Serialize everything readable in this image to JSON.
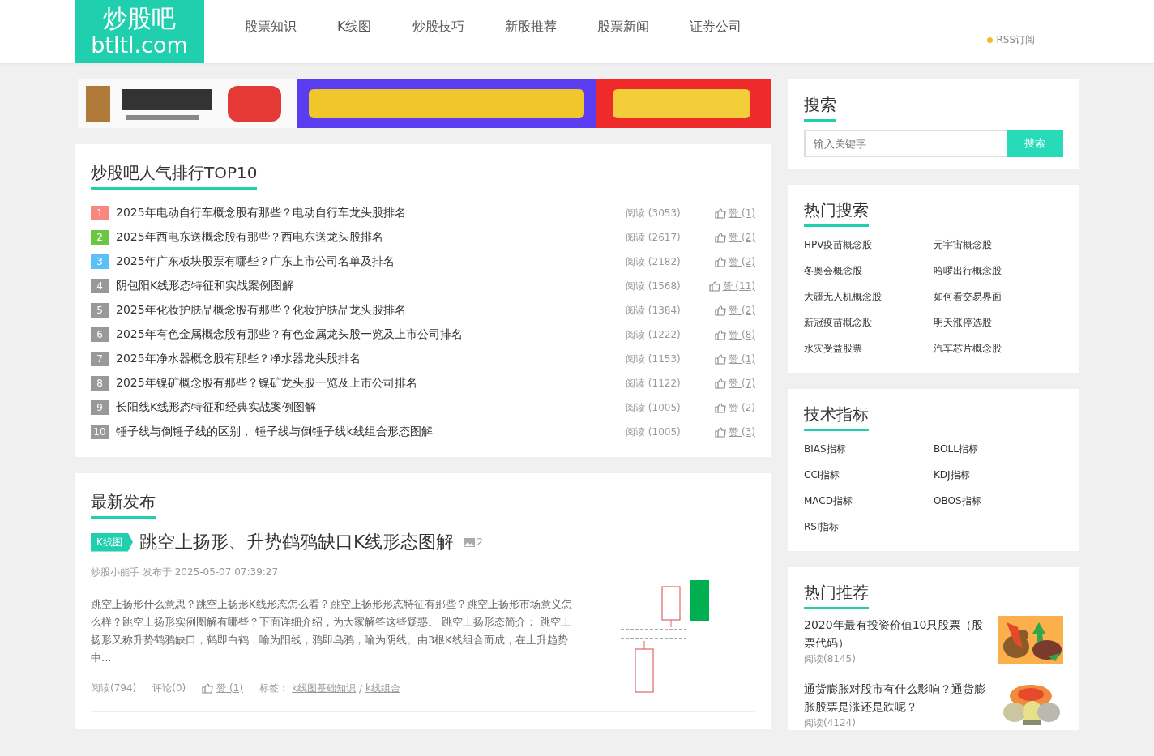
{
  "header": {
    "logo_title": "炒股吧",
    "logo_domain": "btltl.com",
    "nav": [
      {
        "label": "股票知识"
      },
      {
        "label": "K线图"
      },
      {
        "label": "炒股技巧"
      },
      {
        "label": "新股推荐"
      },
      {
        "label": "股票新闻"
      },
      {
        "label": "证券公司"
      }
    ],
    "rss": "RSS订阅"
  },
  "ranking": {
    "title": "炒股吧人气排行TOP10",
    "items": [
      {
        "rank": "1",
        "color": "#f8877f",
        "title": "2025年电动自行车概念股有那些？电动自行车龙头股排名",
        "reads": "阅读 (3053)",
        "likes": "赞 (1)"
      },
      {
        "rank": "2",
        "color": "#6cc644",
        "title": "2025年西电东送概念股有那些？西电东送龙头股排名",
        "reads": "阅读 (2617)",
        "likes": "赞 (2)"
      },
      {
        "rank": "3",
        "color": "#5bc0f8",
        "title": "2025年广东板块股票有哪些？广东上市公司名单及排名",
        "reads": "阅读 (2182)",
        "likes": "赞 (2)"
      },
      {
        "rank": "4",
        "color": "#999999",
        "title": "阴包阳K线形态特征和实战案例图解",
        "reads": "阅读 (1568)",
        "likes": "赞 (11)"
      },
      {
        "rank": "5",
        "color": "#999999",
        "title": "2025年化妆护肤品概念股有那些？化妆护肤品龙头股排名",
        "reads": "阅读 (1384)",
        "likes": "赞 (2)"
      },
      {
        "rank": "6",
        "color": "#999999",
        "title": "2025年有色金属概念股有那些？有色金属龙头股一览及上市公司排名",
        "reads": "阅读 (1222)",
        "likes": "赞 (8)"
      },
      {
        "rank": "7",
        "color": "#999999",
        "title": "2025年净水器概念股有那些？净水器龙头股排名",
        "reads": "阅读 (1153)",
        "likes": "赞 (1)"
      },
      {
        "rank": "8",
        "color": "#999999",
        "title": "2025年镍矿概念股有那些？镍矿龙头股一览及上市公司排名",
        "reads": "阅读 (1122)",
        "likes": "赞 (7)"
      },
      {
        "rank": "9",
        "color": "#999999",
        "title": "长阳线K线形态特征和经典实战案例图解",
        "reads": "阅读 (1005)",
        "likes": "赞 (2)"
      },
      {
        "rank": "10",
        "color": "#999999",
        "title": "锤子线与倒锤子线的区别， 锤子线与倒锤子线k线组合形态图解",
        "reads": "阅读 (1005)",
        "likes": "赞 (3)"
      }
    ]
  },
  "latest": {
    "title": "最新发布",
    "articles": [
      {
        "tag": "K线图",
        "title": "跳空上扬形、升势鹤鸦缺口K线形态图解",
        "image_count": "2",
        "meta": "炒股小能手 发布于 2025-05-07 07:39:27",
        "summary": "跳空上扬形什么意思？跳空上扬形K线形态怎么看？跳空上扬形形态特征有那些？跳空上扬形市场意义怎么样？跳空上扬形实例图解有哪些？下面详细介绍，为大家解答这些疑惑。 跳空上扬形态简介： 跳空上扬形又称升势鹤鸦缺口，鹤即白鹤，喻为阳线，鸦即乌鸦，喻为阴线。由3根K线组合而成，在上升趋势中...",
        "reads": "阅读(794)",
        "comments": "评论(0)",
        "likes": "赞 (1)",
        "tags_label": "标签：",
        "tags": [
          "k线图基础知识",
          "k线组合"
        ],
        "tag_separator": "/"
      }
    ]
  },
  "sidebar": {
    "search": {
      "title": "搜索",
      "placeholder": "输入关键字",
      "button": "搜索"
    },
    "hot_search": {
      "title": "热门搜索",
      "links": [
        "HPV疫苗概念股",
        "元宇宙概念股",
        "冬奥会概念股",
        "哈啰出行概念股",
        "大疆无人机概念股",
        "如何看交易界面",
        "新冠疫苗概念股",
        "明天涨停选股",
        "水灾受益股票",
        "汽车芯片概念股"
      ]
    },
    "indicators": {
      "title": "技术指标",
      "links": [
        "BIAS指标",
        "BOLL指标",
        "CCI指标",
        "KDJ指标",
        "MACD指标",
        "OBOS指标",
        "RSI指标"
      ]
    },
    "recommend": {
      "title": "热门推荐",
      "items": [
        {
          "title": "2020年最有投资价值10只股票（股票代码）",
          "reads": "阅读(8145)",
          "kind": "picture"
        },
        {
          "title": "通货膨胀对股市有什么影响？通货膨胀股票是涨还是跌呢？",
          "reads": "阅读(4124)",
          "kind": "picture"
        }
      ]
    }
  }
}
